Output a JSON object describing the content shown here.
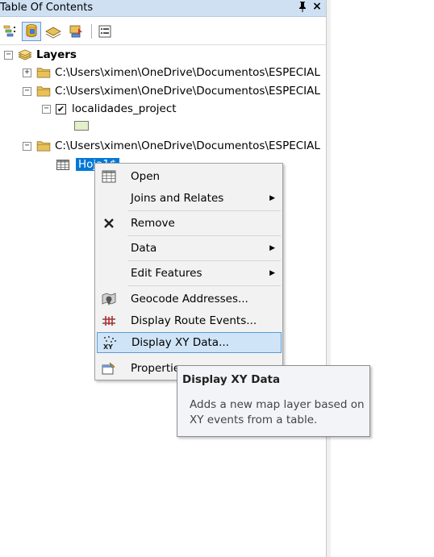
{
  "window": {
    "title": "Table Of Contents",
    "pin_glyph": "ɹ",
    "close_glyph": "×"
  },
  "toolbar": {
    "buttons": [
      {
        "name": "list-by-drawing-order-icon",
        "active": false
      },
      {
        "name": "list-by-source-icon",
        "active": true
      },
      {
        "name": "list-by-visibility-icon",
        "active": false
      },
      {
        "name": "list-by-selection-icon",
        "active": false
      },
      {
        "name": "options-icon",
        "active": false
      }
    ]
  },
  "tree": {
    "layers_label": "Layers",
    "expand_minus": "−",
    "expand_plus": "+",
    "folders": [
      {
        "path": "C:\\Users\\ximen\\OneDrive\\Documentos\\ESPECIAL",
        "expanded": false
      },
      {
        "path": "C:\\Users\\ximen\\OneDrive\\Documentos\\ESPECIAL",
        "expanded": true
      },
      {
        "path": "C:\\Users\\ximen\\OneDrive\\Documentos\\ESPECIAL",
        "expanded": true
      }
    ],
    "layer": {
      "name": "localidades_project",
      "checked": true,
      "check_glyph": "✔"
    },
    "table": {
      "name": "Hoja1$"
    }
  },
  "context_menu": {
    "items": [
      {
        "label": "Open",
        "icon": "table-icon",
        "submenu": false
      },
      {
        "label": "Joins and Relates",
        "icon": "",
        "submenu": true
      },
      {
        "label": "Remove",
        "icon": "remove-x-icon",
        "submenu": false
      },
      {
        "label": "Data",
        "icon": "",
        "submenu": true
      },
      {
        "label": "Edit Features",
        "icon": "",
        "submenu": true
      },
      {
        "label": "Geocode Addresses...",
        "icon": "geocode-icon",
        "submenu": false
      },
      {
        "label": "Display Route Events...",
        "icon": "route-events-icon",
        "submenu": false
      },
      {
        "label": "Display XY Data...",
        "icon": "xy-data-icon",
        "submenu": false
      },
      {
        "label": "Properties...",
        "icon": "properties-icon",
        "submenu": false
      }
    ],
    "submenu_arrow": "▶",
    "hover_index": 7
  },
  "tooltip": {
    "title": "Display XY Data",
    "body": "Adds a new map layer based on XY events from a table."
  },
  "colors": {
    "titlebar": "#cfe0f3",
    "selection": "#0078d7",
    "menu_hover": "#cfe4f7",
    "folder": "#e8c15a"
  }
}
